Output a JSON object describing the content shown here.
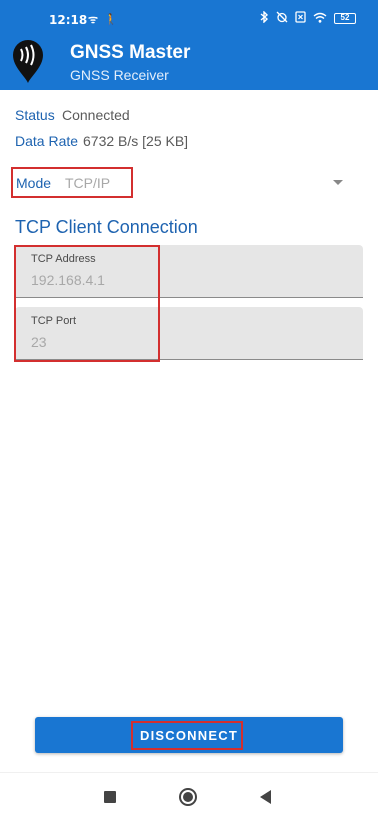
{
  "status_bar": {
    "time": "12:18",
    "left_icons": [
      "wifi-signal-icon",
      "walk-icon"
    ],
    "right_icons": [
      "bluetooth-icon",
      "alarm-off-icon",
      "sim-x-icon",
      "wifi-icon",
      "battery-icon"
    ],
    "battery_level": "52"
  },
  "app_bar": {
    "title": "GNSS Master",
    "subtitle": "GNSS Receiver",
    "color": "#1976d2"
  },
  "info": {
    "status_label": "Status",
    "status_value": "Connected",
    "data_rate_label": "Data Rate",
    "data_rate_value": "6732 B/s [25 KB]"
  },
  "mode": {
    "label": "Mode",
    "value": "TCP/IP"
  },
  "section": {
    "title": "TCP Client Connection"
  },
  "fields": [
    {
      "label": "TCP Address",
      "value": "192.168.4.1"
    },
    {
      "label": "TCP Port",
      "value": "23"
    }
  ],
  "action": {
    "disconnect_label": "DISCONNECT"
  },
  "highlight_color": "#d32f2f"
}
